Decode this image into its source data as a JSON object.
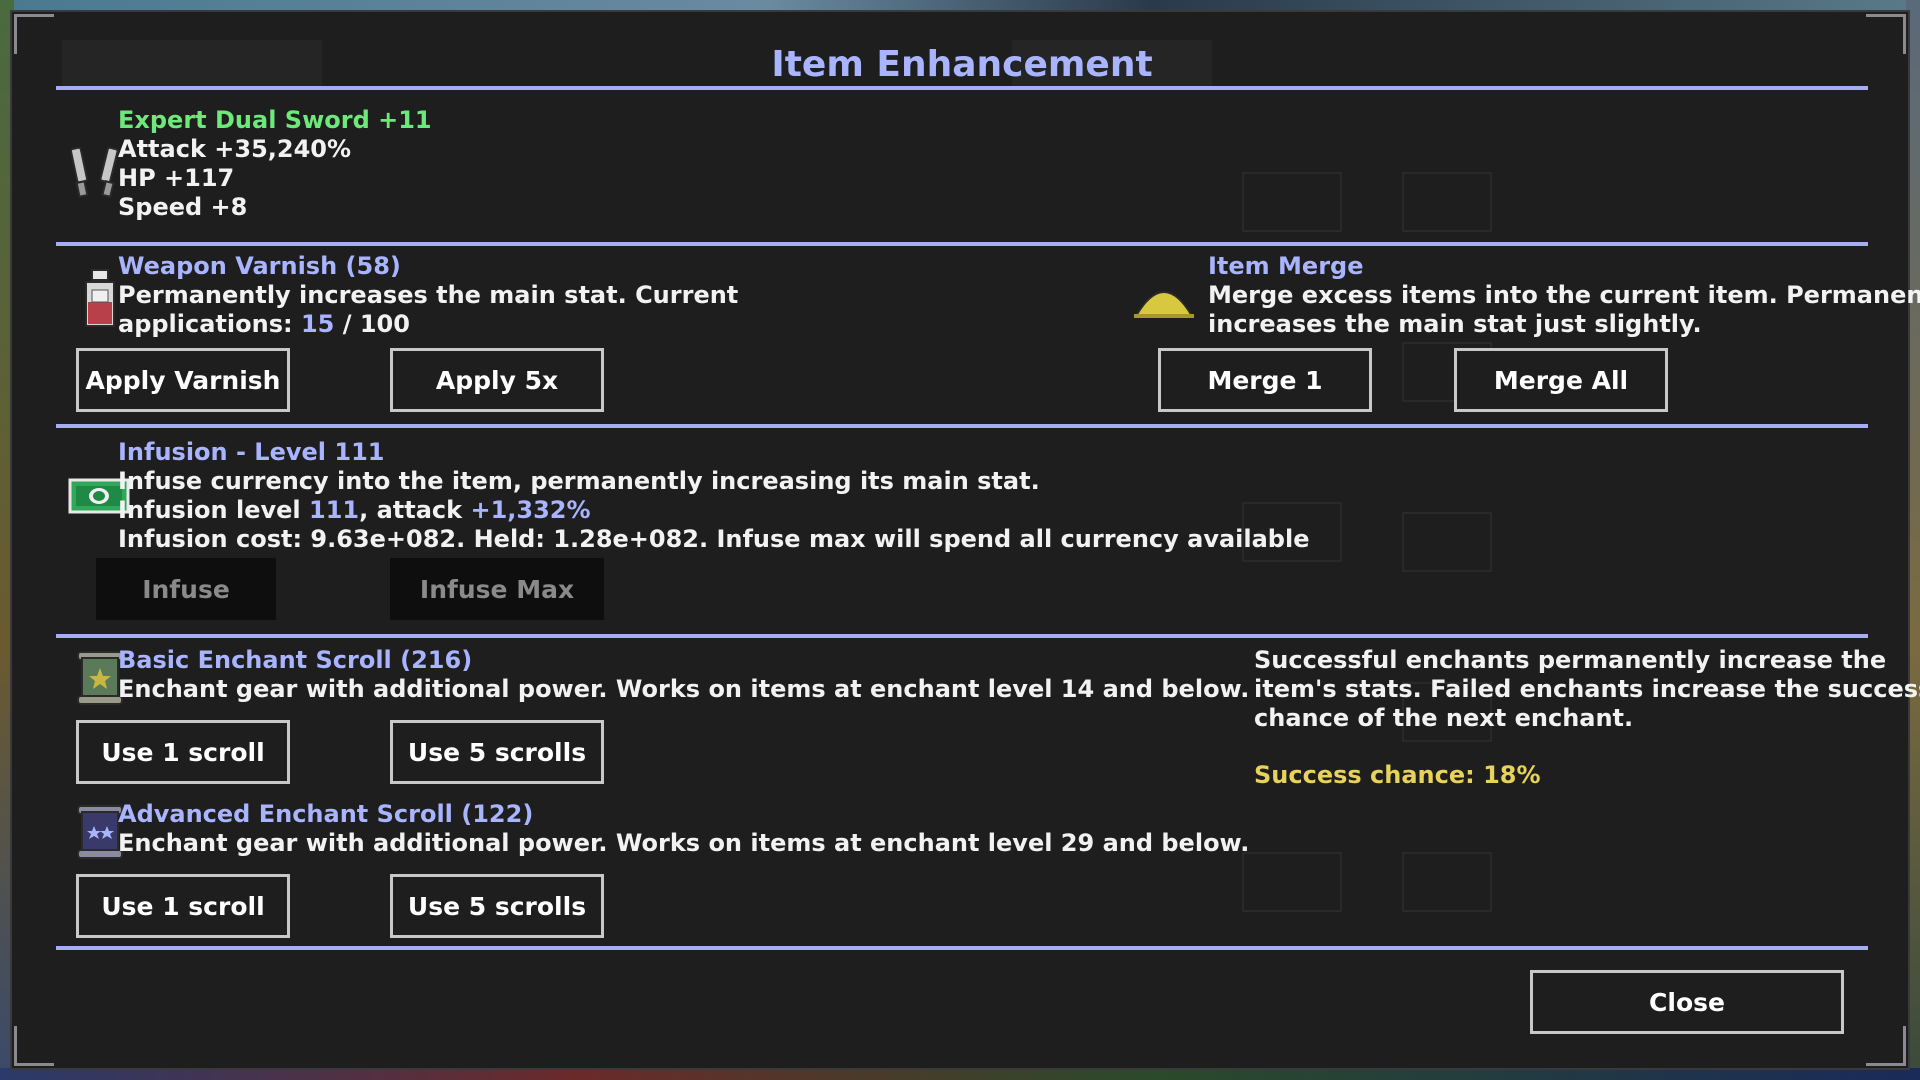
{
  "title": "Item Enhancement",
  "item": {
    "name": "Expert Dual Sword +11",
    "stats": [
      "Attack +35,240%",
      "HP +117",
      "Speed +8"
    ]
  },
  "varnish": {
    "name": "Weapon Varnish (58)",
    "desc1": "Permanently increases the main stat. Current",
    "desc2_prefix": "applications: ",
    "applications_current": "15",
    "applications_sep": " / ",
    "applications_max": "100",
    "apply_label": "Apply Varnish",
    "apply5_label": "Apply 5x"
  },
  "merge": {
    "name": "Item Merge",
    "desc1": "Merge excess items into the current item. Permanently",
    "desc2": "increases the main stat just slightly.",
    "merge1_label": "Merge 1",
    "merge_all_label": "Merge All"
  },
  "infusion": {
    "name": "Infusion - Level 111",
    "desc1": "Infuse currency into the item, permanently increasing its main stat.",
    "level_prefix": "Infusion level ",
    "level_value": "111",
    "attack_prefix": ", attack ",
    "attack_value": "+1,332%",
    "cost_line": "Infusion cost: 9.63e+082. Held: 1.28e+082. Infuse max will spend all currency available",
    "infuse_label": "Infuse",
    "infuse_max_label": "Infuse Max"
  },
  "basic_scroll": {
    "name": "Basic Enchant Scroll (216)",
    "desc": "Enchant gear with additional power. Works on items at enchant level 14 and below.",
    "use1_label": "Use 1 scroll",
    "use5_label": "Use 5 scrolls"
  },
  "advanced_scroll": {
    "name": "Advanced Enchant Scroll (122)",
    "desc": "Enchant gear with additional power. Works on items at enchant level 29 and below.",
    "use1_label": "Use 1 scroll",
    "use5_label": "Use 5 scrolls"
  },
  "enchant_info": {
    "line1": "Successful enchants permanently increase the",
    "line2": "item's stats. Failed enchants increase the success",
    "line3": "chance of the next enchant.",
    "success_label": "Success chance: 18%"
  },
  "close_label": "Close",
  "colors": {
    "title": "#a9b4ff",
    "item_name": "#6ee87a",
    "accent": "#a9b4ff",
    "success": "#e8d35a",
    "divider": "#a5aef5"
  },
  "icons": {
    "item": "dual-sword-icon",
    "varnish": "varnish-bottle-icon",
    "merge": "merge-pile-icon",
    "infusion": "banknote-icon",
    "basic_scroll": "basic-scroll-icon",
    "advanced_scroll": "advanced-scroll-icon"
  }
}
